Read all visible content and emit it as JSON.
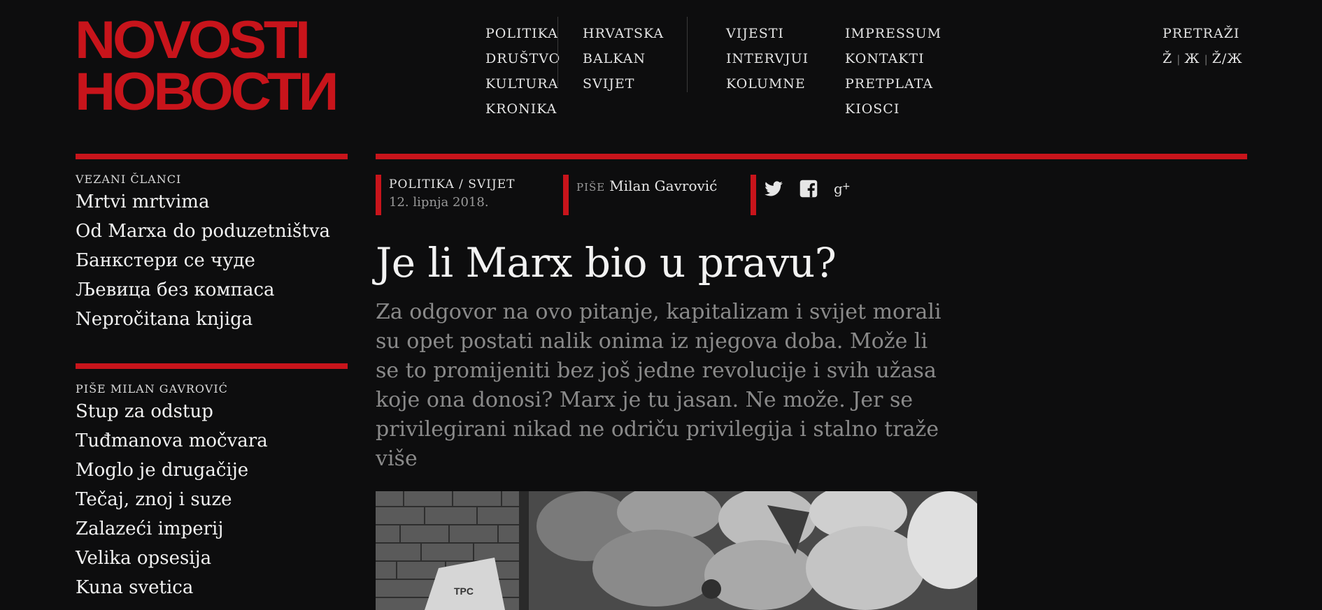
{
  "logo": {
    "line1": "NOVOSTI",
    "line2": "НОВОСТИ",
    "color": "#c8141b"
  },
  "nav": {
    "col1": [
      "POLITIKA",
      "DRUŠTVO",
      "KULTURA",
      "KRONIKA"
    ],
    "col2": [
      "HRVATSKA",
      "BALKAN",
      "SVIJET"
    ],
    "col3": [
      "VIJESTI",
      "INTERVJUI",
      "KOLUMNE"
    ],
    "col4": [
      "IMPRESSUM",
      "KONTAKTI",
      "PRETPLATA",
      "KIOSCI"
    ]
  },
  "utility": {
    "search_label": "PRETRAŽI",
    "scripts": [
      "Ž",
      "Ж",
      "Ž/Ж"
    ]
  },
  "sidebar": {
    "related": {
      "title": "VEZANI ČLANCI",
      "items": [
        "Mrtvi mrtvima",
        "Od Marxa do poduzetništva",
        "Банкстери се чуде",
        "Љевица без компаса",
        "Nepročitana knjiga"
      ]
    },
    "author": {
      "title": "PIŠE MILAN GAVROVIĆ",
      "items": [
        "Stup za odstup",
        "Tuđmanova močvara",
        "Moglo je drugačije",
        "Tečaj, znoj i suze",
        "Zalazeći imperij",
        "Velika opsesija",
        "Kuna svetica"
      ]
    }
  },
  "article": {
    "category": "POLITIKA / SVIJET",
    "date": "12. lipnja 2018.",
    "by_label": "PIŠE",
    "author": "Milan Gavrović",
    "title": "Je li Marx bio u pravu?",
    "lead": "Za odgovor na ovo pitanje, kapitalizam i svijet morali su opet postati nalik onima iz njegova doba. Može li se to promijeniti bez još jedne revolucije i svih užasa koje ona donosi? Marx je tu jasan. Ne može. Jer se privilegirani nikad ne odriču privilegija i stalno traže više",
    "photo_caption_visible": "TPC"
  },
  "social": [
    "twitter-icon",
    "facebook-icon",
    "google-plus-icon"
  ],
  "colors": {
    "background": "#0d0d0e",
    "accent": "#c8141b",
    "muted_text": "#8a8a8a"
  }
}
